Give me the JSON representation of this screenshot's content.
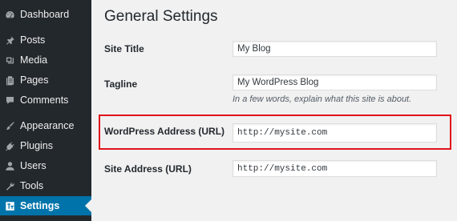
{
  "sidebar": {
    "items": [
      {
        "label": "Dashboard",
        "icon": "dashboard-icon"
      },
      {
        "label": "Posts",
        "icon": "pin-icon"
      },
      {
        "label": "Media",
        "icon": "media-icon"
      },
      {
        "label": "Pages",
        "icon": "pages-icon"
      },
      {
        "label": "Comments",
        "icon": "comment-icon"
      },
      {
        "label": "Appearance",
        "icon": "brush-icon"
      },
      {
        "label": "Plugins",
        "icon": "plug-icon"
      },
      {
        "label": "Users",
        "icon": "user-icon"
      },
      {
        "label": "Tools",
        "icon": "wrench-icon"
      },
      {
        "label": "Settings",
        "icon": "settings-icon"
      }
    ],
    "active": "Settings"
  },
  "main": {
    "title": "General Settings",
    "site_title": {
      "label": "Site Title",
      "value": "My Blog"
    },
    "tagline": {
      "label": "Tagline",
      "value": "My WordPress Blog",
      "description": "In a few words, explain what this site is about."
    },
    "wp_address": {
      "label": "WordPress Address (URL)",
      "value": "http://mysite.com"
    },
    "site_address": {
      "label": "Site Address (URL)",
      "value": "http://mysite.com"
    }
  },
  "colors": {
    "sidebar_bg": "#23282d",
    "active_bg": "#0073aa",
    "highlight": "#e0121a",
    "page_bg": "#f1f1f1"
  }
}
